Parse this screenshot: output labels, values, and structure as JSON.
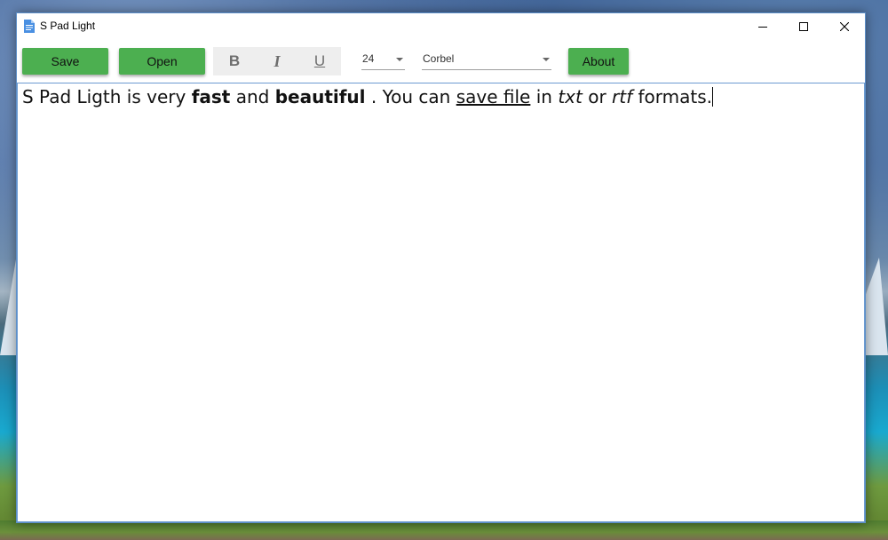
{
  "window": {
    "title": "S Pad Light",
    "controls": {
      "minimize_icon": "minimize-icon",
      "maximize_icon": "maximize-icon",
      "close_icon": "close-icon"
    }
  },
  "toolbar": {
    "save_label": "Save",
    "open_label": "Open",
    "bold_label": "B",
    "italic_label": "I",
    "underline_label": "U",
    "font_size": "24",
    "font_family": "Corbel",
    "about_label": "About",
    "accent_color": "#4caf50"
  },
  "editor": {
    "segments": [
      "S Pad Ligth is very ",
      "fast",
      " and ",
      "beautiful",
      " . You can ",
      "save file",
      " in ",
      "txt",
      " or ",
      "rtf",
      " formats."
    ]
  }
}
